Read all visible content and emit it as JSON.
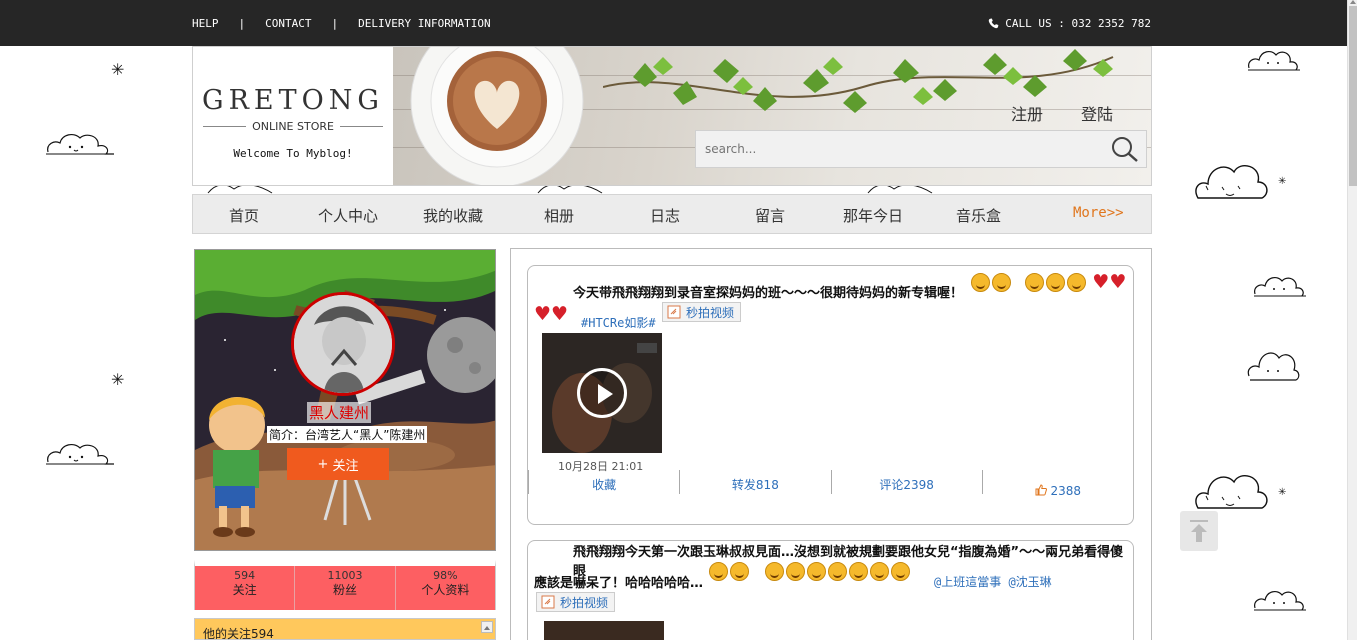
{
  "topbar": {
    "links": [
      "HELP",
      "CONTACT",
      "DELIVERY INFORMATION"
    ],
    "separator": "|",
    "call": "CALL US : 032 2352 782",
    "phone_icon": "phone-icon"
  },
  "header": {
    "brand": "GRETONG",
    "subtitle": "ONLINE STORE",
    "welcome": "Welcome To Myblog!",
    "register": "注册",
    "login": "登陆",
    "search_placeholder": "search..."
  },
  "nav": {
    "items": [
      "首页",
      "个人中心",
      "我的收藏",
      "相册",
      "日志",
      "留言",
      "那年今日",
      "音乐盒"
    ],
    "more": "More>>"
  },
  "profile": {
    "name": "黑人建州",
    "intro": "简介：台湾艺人“黑人”陈建州",
    "follow_label": "关注",
    "follow_plus": "+",
    "stats": [
      {
        "value": "594",
        "label": "关注"
      },
      {
        "value": "11003",
        "label": "粉丝"
      },
      {
        "value": "98%",
        "label": "个人资料"
      }
    ],
    "following_title": "他的关注594"
  },
  "feed": {
    "posts": [
      {
        "text": "今天带飛飛翔翔到录音室探妈妈的班～～～很期待妈妈的新专辑喔！",
        "tag": "#HTCRe如影#",
        "video_button": "秒拍视频",
        "date": "10月28日 21:01",
        "actions": {
          "collect": "收藏",
          "repost": "转发818",
          "comment": "评论2398",
          "like": "2388"
        }
      },
      {
        "text_line1": "飛飛翔翔今天第一次跟玉琳叔叔見面…沒想到就被規劃要跟他女兒“指腹為婚”～～兩兄弟看得傻眼",
        "text_line2": "應該是嚇呆了！哈哈哈哈哈…",
        "mentions": "@上班這當事 @沈玉琳",
        "video_button": "秒拍视频"
      }
    ]
  },
  "colors": {
    "topbar": "#262626",
    "accent_orange": "#f05a1e",
    "stats_bg": "#fd5f62",
    "link_blue": "#2e6fba",
    "more_orange": "#e0761d"
  }
}
